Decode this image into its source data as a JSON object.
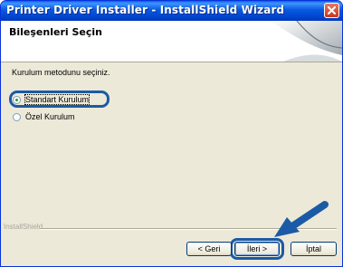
{
  "window": {
    "title": "Printer Driver Installer - InstallShield Wizard"
  },
  "header": {
    "title": "Bileşenleri Seçin"
  },
  "body": {
    "prompt": "Kurulum metodunu seçiniz.",
    "options": [
      {
        "label": "Standart Kurulum",
        "selected": true
      },
      {
        "label": "Özel Kurulum",
        "selected": false
      }
    ]
  },
  "footer": {
    "brand": "InstallShield",
    "back_label": "< Geri",
    "next_label": "İleri >",
    "cancel_label": "İptal"
  },
  "colors": {
    "titlebar": "#0a58df",
    "highlight": "#1b5aa6",
    "radio_dot": "#21a121"
  }
}
